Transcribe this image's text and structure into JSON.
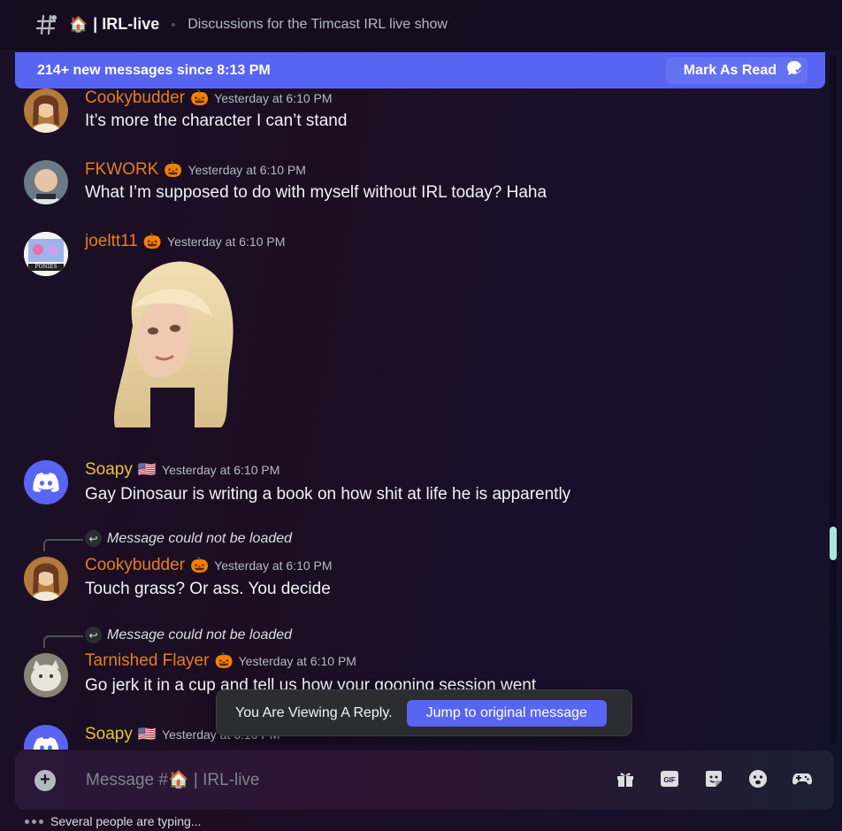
{
  "header": {
    "channel_emoji": "🏠",
    "channel_name": "| IRL-live",
    "topic": "Discussions for the Timcast IRL live show"
  },
  "banner": {
    "text": "214+ new messages since 8:13 PM",
    "mark_read_label": "Mark As Read"
  },
  "messages": [
    {
      "author": "Cookybudder",
      "role_emoji": "🎃",
      "timestamp": "Yesterday at 6:10 PM",
      "text": "It’s more the character I can’t stand",
      "avatar_icon": "user-avatar"
    },
    {
      "author": "FKWORK",
      "role_emoji": "🎃",
      "timestamp": "Yesterday at 6:10 PM",
      "text": "What I’m supposed to do with myself without IRL today? Haha",
      "avatar_icon": "user-avatar"
    },
    {
      "author": "joeltt11",
      "role_emoji": "🎃",
      "timestamp": "Yesterday at 6:10 PM",
      "text": "",
      "avatar_icon": "user-avatar",
      "avatar_text": "PONIES",
      "attachment": "sticker-image"
    },
    {
      "author": "Soapy",
      "role_emoji": "🇺🇸",
      "timestamp": "Yesterday at 6:10 PM",
      "text": "Gay Dinosaur is writing a book on how shit at life he is apparently",
      "avatar_icon": "discord-icon"
    },
    {
      "reply_text": "Message could not be loaded",
      "author": "Cookybudder",
      "role_emoji": "🎃",
      "timestamp": "Yesterday at 6:10 PM",
      "text": "Touch grass? Or ass. You decide",
      "avatar_icon": "user-avatar"
    },
    {
      "reply_text": "Message could not be loaded",
      "author": "Tarnished Flayer",
      "role_emoji": "🎃",
      "timestamp": "Yesterday at 6:10 PM",
      "text": "Go jerk it in a cup and tell us how your gooning session went",
      "avatar_icon": "user-avatar"
    },
    {
      "author": "Soapy",
      "role_emoji": "🇺🇸",
      "timestamp": "Yesterday at 6:10 PM",
      "text": "",
      "avatar_icon": "discord-icon"
    }
  ],
  "toast": {
    "label": "You Are Viewing A Reply.",
    "button": "Jump to original message"
  },
  "composer": {
    "placeholder": "Message #🏠 | IRL-live",
    "tools": [
      "gift-icon",
      "gif-icon",
      "sticker-icon",
      "emoji-icon",
      "activities-icon"
    ]
  },
  "typing": {
    "text": "Several people are typing..."
  }
}
